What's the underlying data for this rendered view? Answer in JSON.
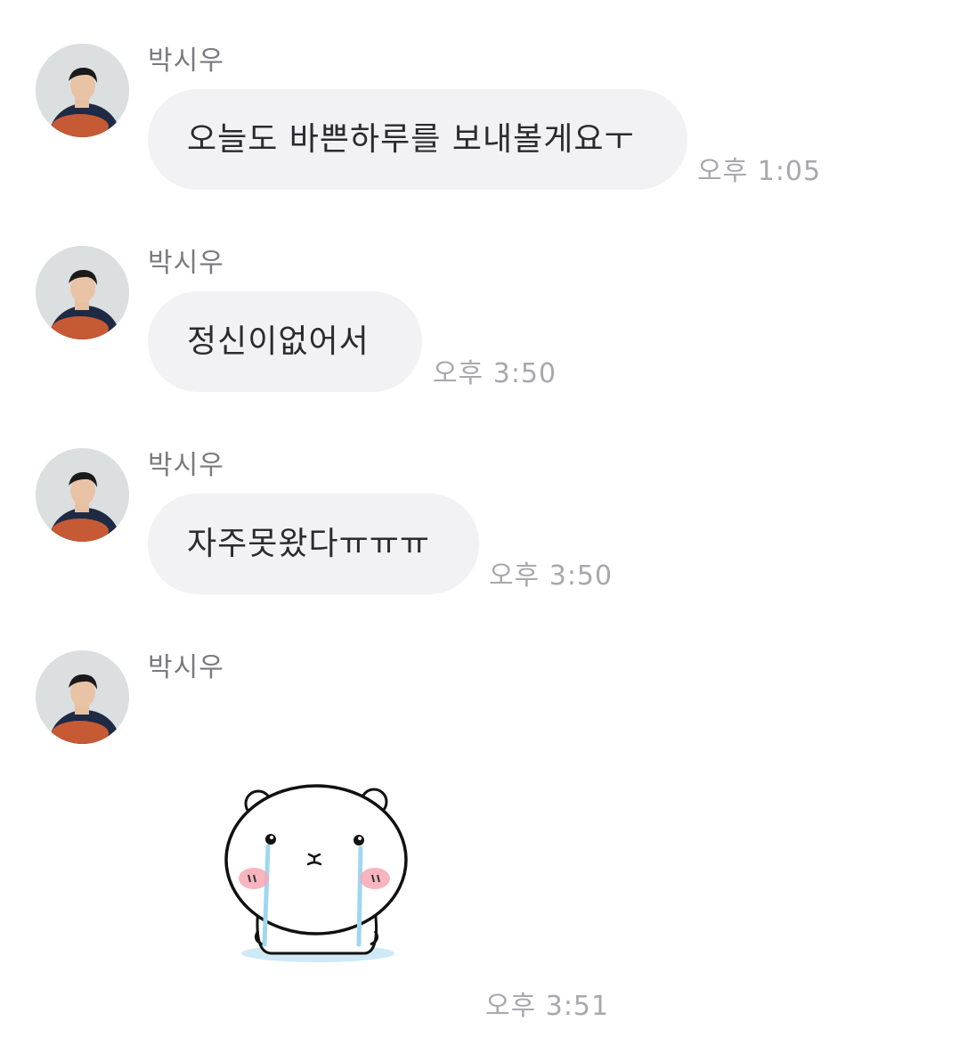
{
  "messages": [
    {
      "sender": "박시우",
      "text": "오늘도 바쁜하루를 보내볼게요ㅜ",
      "time": "오후 1:05"
    },
    {
      "sender": "박시우",
      "text": "정신이없어서",
      "time": "오후 3:50"
    },
    {
      "sender": "박시우",
      "text": "자주못왔다ㅠㅠㅠ",
      "time": "오후 3:50"
    },
    {
      "sender": "박시우",
      "sticker": "crying-bear-sticker",
      "time": "오후 3:51"
    }
  ],
  "colors": {
    "bubble": "#f2f2f4",
    "text": "#2b2b2f",
    "sender": "#7a7a7f",
    "time": "#a8a8ad"
  }
}
